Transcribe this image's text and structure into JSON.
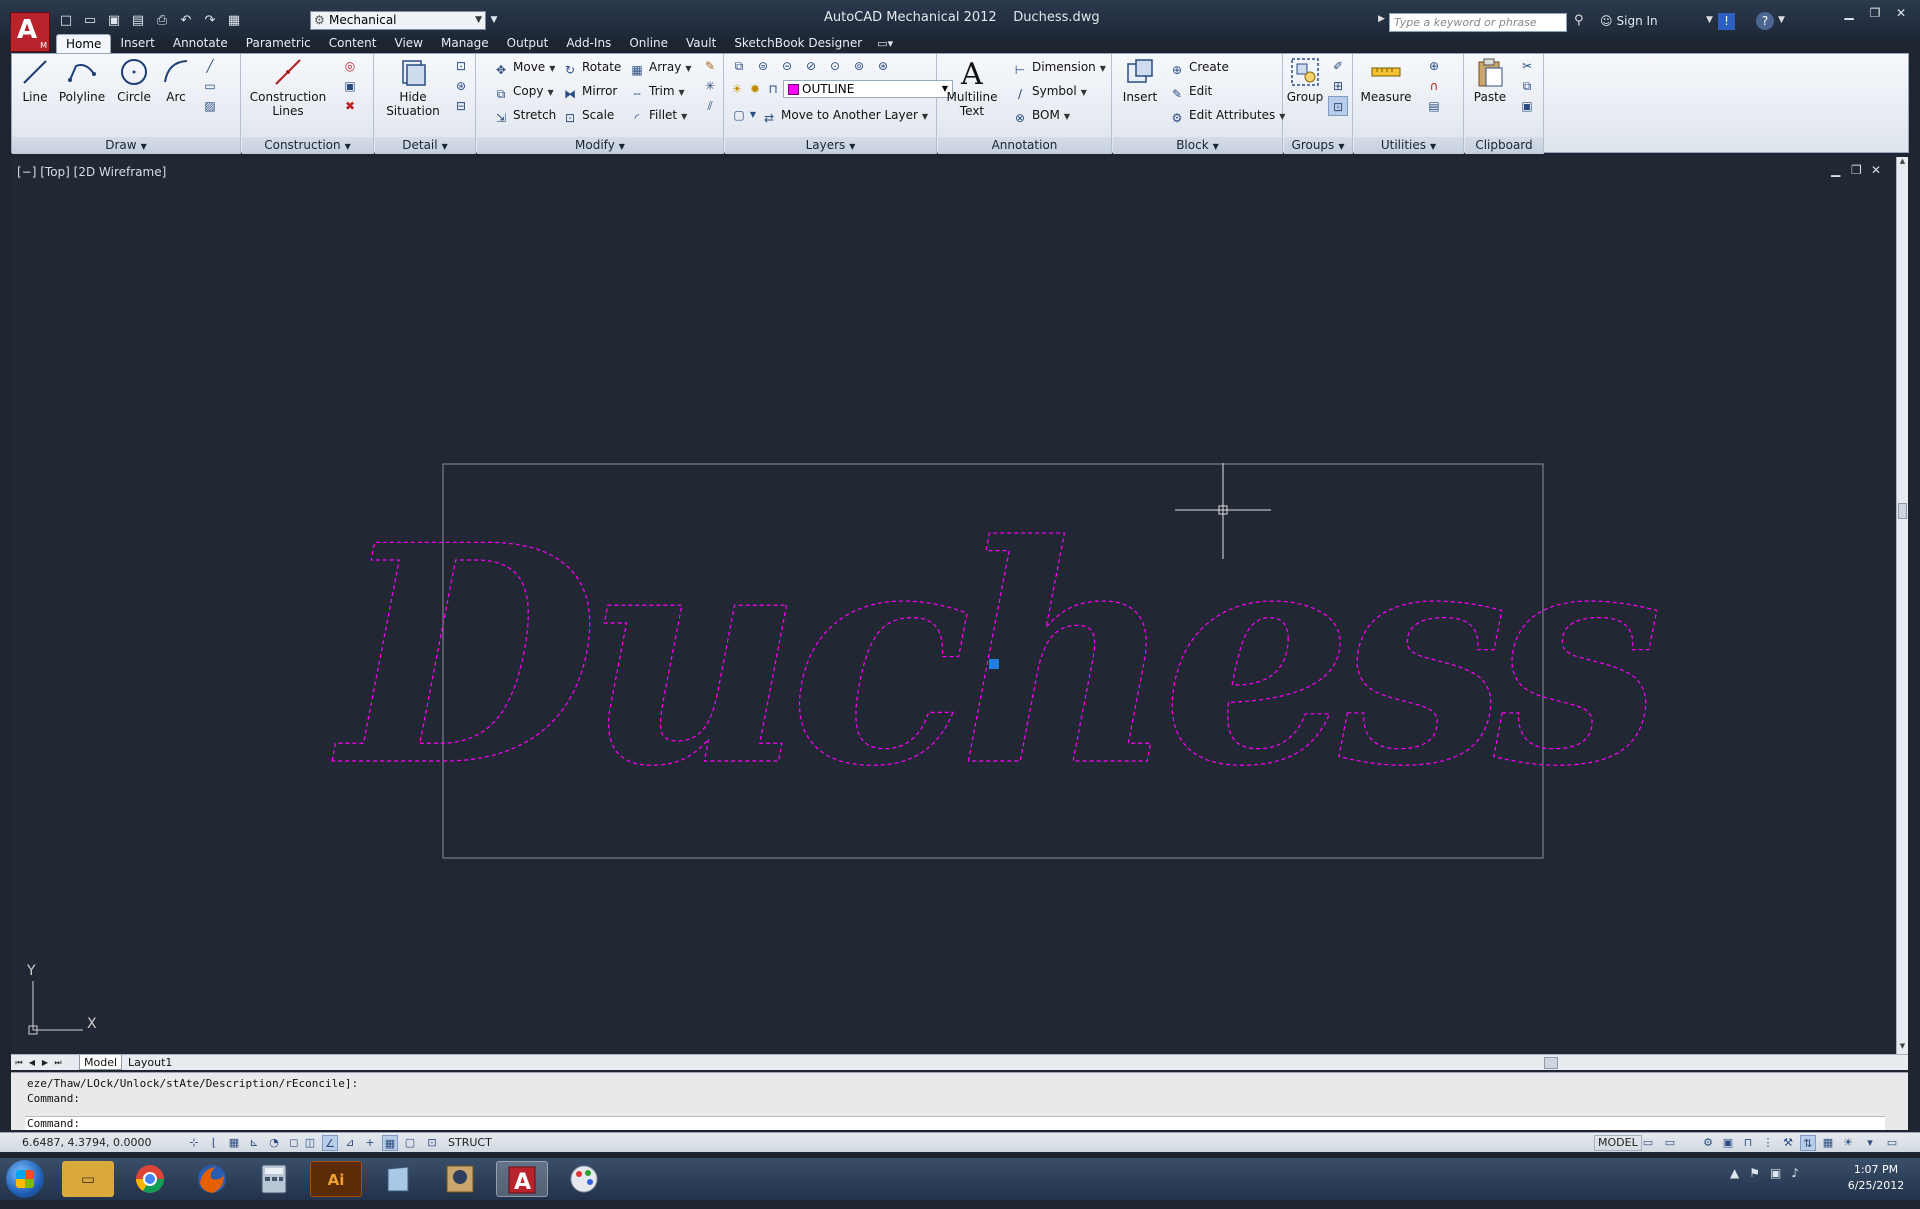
{
  "titlebar": {
    "app_badge": "A",
    "app_badge_sub": "M",
    "workspace": "Mechanical",
    "app_name": "AutoCAD Mechanical 2012",
    "file_name": "Duchess.dwg",
    "search_placeholder": "Type a keyword or phrase",
    "sign_in": "Sign In"
  },
  "tabs": [
    "Home",
    "Insert",
    "Annotate",
    "Parametric",
    "Content",
    "View",
    "Manage",
    "Output",
    "Add-Ins",
    "Online",
    "Vault",
    "SketchBook Designer"
  ],
  "ribbon": {
    "draw": {
      "title": "Draw",
      "line": "Line",
      "polyline": "Polyline",
      "circle": "Circle",
      "arc": "Arc"
    },
    "construction": {
      "title": "Construction",
      "construction_lines_1": "Construction",
      "construction_lines_2": "Lines"
    },
    "detail": {
      "title": "Detail",
      "hide_1": "Hide",
      "hide_2": "Situation"
    },
    "modify": {
      "title": "Modify",
      "move": "Move",
      "copy": "Copy",
      "stretch": "Stretch",
      "rotate": "Rotate",
      "mirror": "Mirror",
      "scale": "Scale",
      "array": "Array",
      "trim": "Trim",
      "fillet": "Fillet"
    },
    "layers": {
      "title": "Layers",
      "current_layer": "OUTLINE",
      "move_to_layer": "Move to Another Layer",
      "layer_color": "#ff00ff"
    },
    "annotation": {
      "title": "Annotation",
      "mtext_1": "Multiline",
      "mtext_2": "Text",
      "dimension": "Dimension",
      "symbol": "Symbol",
      "bom": "BOM"
    },
    "block": {
      "title": "Block",
      "insert": "Insert",
      "create": "Create",
      "edit": "Edit",
      "edit_attributes": "Edit Attributes"
    },
    "groups": {
      "title": "Groups",
      "group": "Group"
    },
    "utilities": {
      "title": "Utilities",
      "measure": "Measure"
    },
    "clipboard": {
      "title": "Clipboard",
      "paste": "Paste"
    }
  },
  "viewport": {
    "label": "[−] [Top] [2D Wireframe]",
    "drawing_text": "Duchess",
    "outline_color": "#ff00ff",
    "axis_y": "Y",
    "axis_x": "X"
  },
  "layout_tabs": [
    "Model",
    "Layout1"
  ],
  "command": {
    "history_1": "eze/Thaw/LOck/Unlock/stAte/Description/rEconcile]:",
    "history_2": "Command:",
    "prompt": "Command:"
  },
  "status": {
    "coordinates": "6.6487, 4.3794, 0.0000",
    "struct": "STRUCT",
    "model": "MODEL"
  },
  "taskbar": {
    "time": "1:07 PM",
    "date": "6/25/2012"
  }
}
